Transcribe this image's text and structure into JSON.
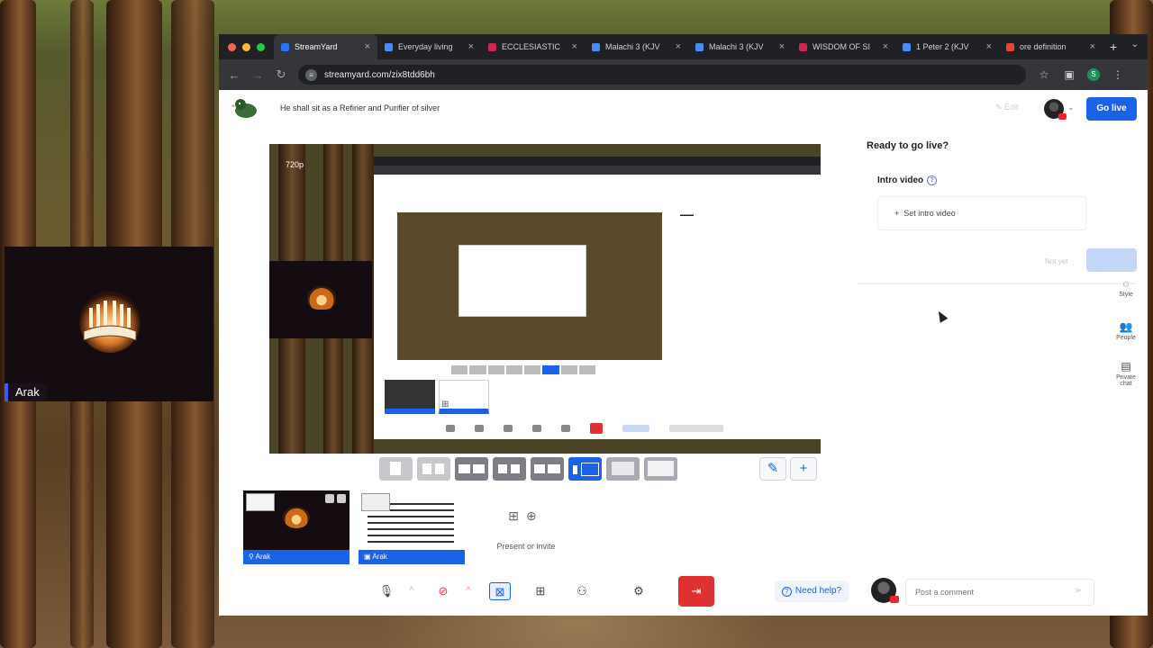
{
  "camera_overlay": {
    "name": "Arak"
  },
  "browser": {
    "tabs": [
      {
        "label": "StreamYard",
        "favicon_color": "#2b6fff",
        "active": true
      },
      {
        "label": "Everyday living",
        "favicon_color": "#4c8bf5"
      },
      {
        "label": "ECCLESIASTIC",
        "favicon_color": "#d0254f"
      },
      {
        "label": "Malachi 3 (KJV",
        "favicon_color": "#4c8bf5"
      },
      {
        "label": "Malachi 3 (KJV",
        "favicon_color": "#4c8bf5"
      },
      {
        "label": "WISDOM OF SI",
        "favicon_color": "#d0254f"
      },
      {
        "label": "1 Peter 2 (KJV",
        "favicon_color": "#4c8bf5"
      },
      {
        "label": "ore definition",
        "favicon_color": "#ea4335"
      }
    ],
    "url": "streamyard.com/zix8tdd6bh"
  },
  "app": {
    "broadcast_title": "He shall sit as a Refiner and Purifier of silver",
    "edit_label": "Edit",
    "go_live_label": "Go live",
    "stage_resolution": "720p",
    "participants": [
      {
        "name": "Arak",
        "type": "camera"
      },
      {
        "name": "Arak",
        "type": "screen"
      }
    ],
    "invite_label": "Present or invite",
    "help_label": "Need help?",
    "comment_placeholder": "Post a comment"
  },
  "panel": {
    "title": "Ready to go live?",
    "intro_label": "Intro video",
    "set_intro_label": "Set intro video",
    "not_yet_label": "Not yet",
    "rail": [
      {
        "label": "Style",
        "icon": "brush-icon"
      },
      {
        "label": "People",
        "icon": "people-icon"
      },
      {
        "label": "Private chat",
        "icon": "chat-icon"
      }
    ]
  },
  "colors": {
    "accent": "#1a62e8",
    "leave": "#e03131"
  }
}
